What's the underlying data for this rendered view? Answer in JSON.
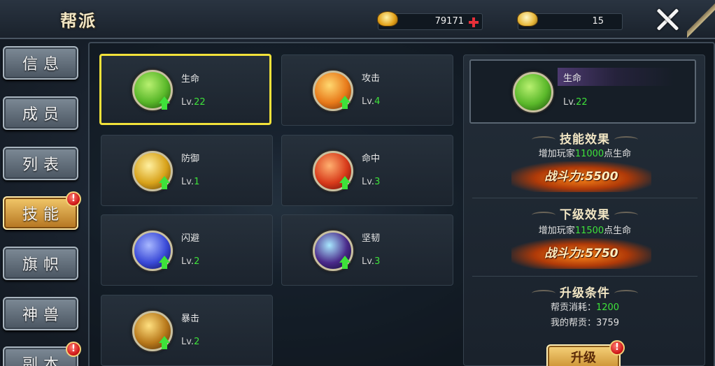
{
  "header": {
    "title": "帮派",
    "coins": "79171",
    "ingots": "15"
  },
  "tabs": [
    {
      "label": "信息"
    },
    {
      "label": "成员"
    },
    {
      "label": "列表"
    },
    {
      "label": "技能",
      "active": true,
      "badge": "!"
    },
    {
      "label": "旗帜"
    },
    {
      "label": "神兽"
    },
    {
      "label": "副本",
      "badge": "!"
    }
  ],
  "skills": [
    {
      "name": "生命",
      "lv_prefix": "Lv.",
      "level": "22",
      "icon": "life-icon",
      "color": "#5ab82a",
      "selected": true
    },
    {
      "name": "攻击",
      "lv_prefix": "Lv.",
      "level": "4",
      "icon": "attack-icon",
      "color": "#e87a1a"
    },
    {
      "name": "防御",
      "lv_prefix": "Lv.",
      "level": "1",
      "icon": "defense-icon",
      "color": "#d8a21a"
    },
    {
      "name": "命中",
      "lv_prefix": "Lv.",
      "level": "3",
      "icon": "hit-icon",
      "color": "#d83a1a"
    },
    {
      "name": "闪避",
      "lv_prefix": "Lv.",
      "level": "2",
      "icon": "dodge-icon",
      "color": "#3a4ad8"
    },
    {
      "name": "坚韧",
      "lv_prefix": "Lv.",
      "level": "3",
      "icon": "toughness-icon",
      "color": "#4a2a8a"
    },
    {
      "name": "暴击",
      "lv_prefix": "Lv.",
      "level": "2",
      "icon": "crit-icon",
      "color": "#b8781a"
    }
  ],
  "detail": {
    "name": "生命",
    "lv_prefix": "Lv.",
    "level": "22",
    "effect_title": "技能效果",
    "effect_pre": "增加玩家",
    "effect_value": "11000",
    "effect_post": "点生命",
    "power_label": "战斗力:",
    "power_value": "5500",
    "next_title": "下级效果",
    "next_pre": "增加玩家",
    "next_value": "11500",
    "next_post": "点生命",
    "next_power_label": "战斗力:",
    "next_power_value": "5750",
    "cond_title": "升级条件",
    "cost_label": "帮贡消耗：",
    "cost_value": "1200",
    "mine_label": "我的帮贡：",
    "mine_value": "3759",
    "upgrade_label": "升级",
    "upgrade_badge": "!"
  }
}
